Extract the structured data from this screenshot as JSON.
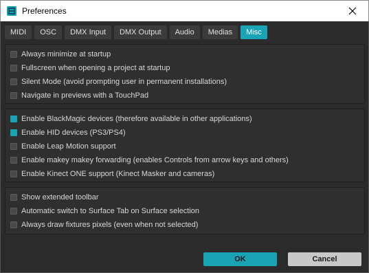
{
  "window": {
    "title": "Preferences"
  },
  "tabs": [
    {
      "label": "MIDI",
      "active": false
    },
    {
      "label": "OSC",
      "active": false
    },
    {
      "label": "DMX Input",
      "active": false
    },
    {
      "label": "DMX Output",
      "active": false
    },
    {
      "label": "Audio",
      "active": false
    },
    {
      "label": "Medias",
      "active": false
    },
    {
      "label": "Misc",
      "active": true
    }
  ],
  "groups": [
    {
      "options": [
        {
          "label": "Always minimize at startup",
          "checked": false
        },
        {
          "label": "Fullscreen when opening a project at startup",
          "checked": false
        },
        {
          "label": "Silent Mode (avoid prompting user in permanent installations)",
          "checked": false
        },
        {
          "label": "Navigate in previews with a TouchPad",
          "checked": false
        }
      ]
    },
    {
      "options": [
        {
          "label": "Enable BlackMagic devices (therefore available in other applications)",
          "checked": true
        },
        {
          "label": "Enable HID devices (PS3/PS4)",
          "checked": true
        },
        {
          "label": "Enable Leap Motion support",
          "checked": false
        },
        {
          "label": "Enable makey makey forwarding (enables Controls from arrow keys and others)",
          "checked": false
        },
        {
          "label": "Enable Kinect ONE support (Kinect Masker and cameras)",
          "checked": false
        }
      ]
    },
    {
      "options": [
        {
          "label": "Show extended toolbar",
          "checked": false
        },
        {
          "label": "Automatic switch to Surface Tab on Surface selection",
          "checked": false
        },
        {
          "label": "Always draw fixtures pixels (even when not selected)",
          "checked": false
        }
      ]
    }
  ],
  "buttons": {
    "ok": "OK",
    "cancel": "Cancel"
  },
  "colors": {
    "accent": "#1aa3b5",
    "background": "#2b2b2b"
  }
}
